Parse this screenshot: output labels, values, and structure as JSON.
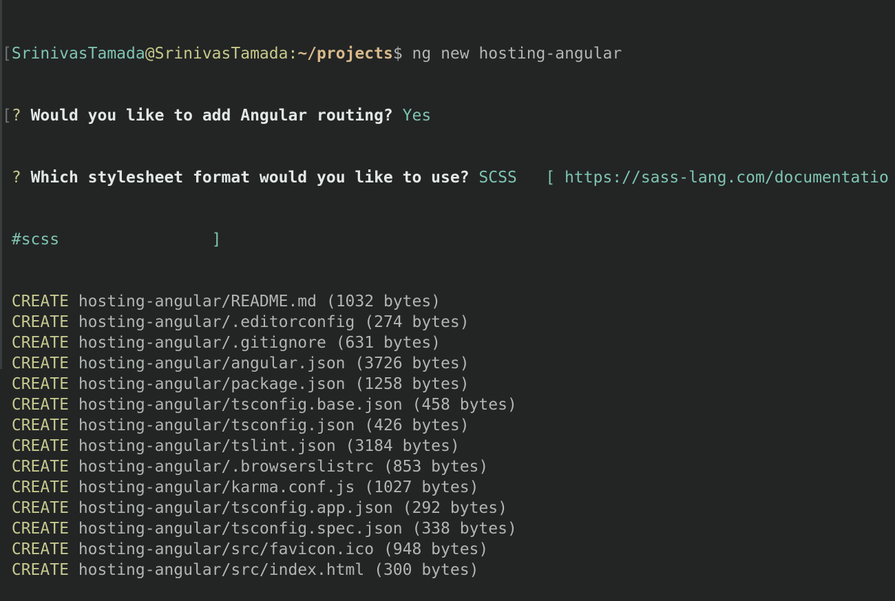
{
  "prompt": {
    "user": "SrinivasTamada",
    "at": "@",
    "host": "SrinivasTamada",
    "colon": ":",
    "path": "~/projects",
    "dollar": "$",
    "command": "ng new hosting-angular"
  },
  "questions": [
    {
      "mark": "?",
      "text": "Would you like to add Angular routing?",
      "answer": "Yes"
    },
    {
      "mark": "?",
      "text": "Which stylesheet format would you like to use?",
      "answer": "SCSS",
      "hint": "[ https://sass-lang.com/documentatio",
      "hint_cont": "#scss                ]"
    }
  ],
  "create_label": "CREATE",
  "created_files": [
    {
      "path": "hosting-angular/README.md",
      "size": "(1032 bytes)"
    },
    {
      "path": "hosting-angular/.editorconfig",
      "size": "(274 bytes)"
    },
    {
      "path": "hosting-angular/.gitignore",
      "size": "(631 bytes)"
    },
    {
      "path": "hosting-angular/angular.json",
      "size": "(3726 bytes)"
    },
    {
      "path": "hosting-angular/package.json",
      "size": "(1258 bytes)"
    },
    {
      "path": "hosting-angular/tsconfig.base.json",
      "size": "(458 bytes)"
    },
    {
      "path": "hosting-angular/tsconfig.json",
      "size": "(426 bytes)"
    },
    {
      "path": "hosting-angular/tslint.json",
      "size": "(3184 bytes)"
    },
    {
      "path": "hosting-angular/.browserslistrc",
      "size": "(853 bytes)"
    },
    {
      "path": "hosting-angular/karma.conf.js",
      "size": "(1027 bytes)"
    },
    {
      "path": "hosting-angular/tsconfig.app.json",
      "size": "(292 bytes)"
    },
    {
      "path": "hosting-angular/tsconfig.spec.json",
      "size": "(338 bytes)"
    },
    {
      "path": "hosting-angular/src/favicon.ico",
      "size": "(948 bytes)"
    },
    {
      "path": "hosting-angular/src/index.html",
      "size": "(300 bytes)"
    }
  ]
}
